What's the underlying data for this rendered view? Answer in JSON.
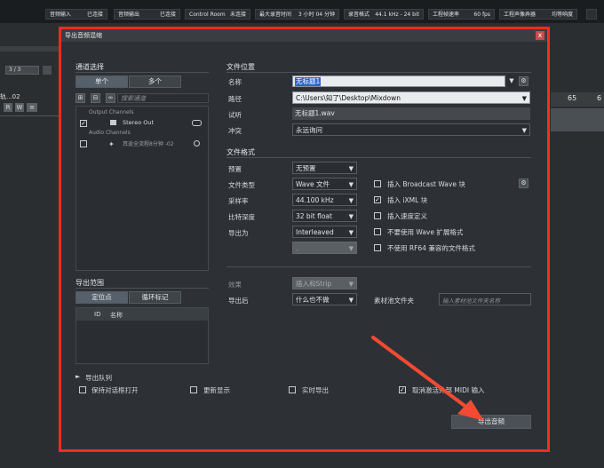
{
  "statusbar": {
    "items": [
      {
        "label": "音频输入",
        "value": "已连接"
      },
      {
        "label": "音频输出",
        "value": "已连接"
      },
      {
        "label": "Control Room",
        "value": "未连接"
      },
      {
        "label": "最大录音时间",
        "value": "3 小时 04 分钟"
      },
      {
        "label": "录音格式",
        "value": "44.1 kHz - 24 bit"
      },
      {
        "label": "工程帧速率",
        "value": "60 fps"
      },
      {
        "label": "工程声像弄器",
        "value": "均等响度"
      }
    ]
  },
  "background": {
    "ruler_numbers": [
      "65",
      "6"
    ],
    "track_counter": "3 / 3",
    "track_name": "轨...02",
    "track_buttons": [
      "R",
      "W",
      "≡"
    ]
  },
  "dialog": {
    "title": "导出音频混缩",
    "close_label": "x",
    "channel_select": {
      "title": "通道选择",
      "tab_single": "单个",
      "tab_multi": "多个",
      "search_placeholder": "搜索通道",
      "tree": {
        "output_group": "Output Channels",
        "output_item": "Stereo Out",
        "audio_group": "Audio Channels",
        "audio_item": "耳返全流程8分钟 -02"
      }
    },
    "export_range": {
      "title": "导出范围",
      "tab_locator": "定位点",
      "tab_cycle": "循环标记",
      "col_id": "ID",
      "col_name": "名称"
    },
    "file_location": {
      "title": "文件位置",
      "name_label": "名称",
      "name_value": "无标题1",
      "path_label": "路径",
      "path_value": "C:\\Users\\知了\\Desktop\\Mixdown",
      "preview_label": "试听",
      "preview_value": "无标题1.wav",
      "conflict_label": "冲突",
      "conflict_value": "永远询问"
    },
    "file_format": {
      "title": "文件格式",
      "preset_label": "预置",
      "preset_value": "无预置",
      "type_label": "文件类型",
      "type_value": "Wave 文件",
      "rate_label": "采样率",
      "rate_value": "44.100 kHz",
      "depth_label": "比特深度",
      "depth_value": "32 bit float",
      "exportas_label": "导出为",
      "exportas_value": "Interleaved",
      "extra_value": ".",
      "opt_bwf": "插入 Broadcast Wave 块",
      "opt_ixml": "插入 iXML 块",
      "opt_tempo": "插入速度定义",
      "opt_no_wave_ext": "不要使用 Wave 扩展格式",
      "opt_no_rf64": "不使用 RF64 兼容的文件格式"
    },
    "post": {
      "effect_label": "效果",
      "effect_value": "插入和Strip",
      "after_label": "导出后",
      "after_value": "什么也不做",
      "pool_label": "素材池文件夹",
      "pool_placeholder": "输入素材池文件夹名称"
    },
    "queue_label": "导出队列",
    "bottom_opts": {
      "keep_open": "保持对话框打开",
      "update_display": "更新显示",
      "realtime": "实时导出",
      "disable_midi": "取消激活外部 MIDI 输入"
    },
    "export_button": "导出音频"
  },
  "colors": {
    "frame": "#ff2a1a",
    "arrow": "#f44a33",
    "selection": "#2e63c8"
  }
}
